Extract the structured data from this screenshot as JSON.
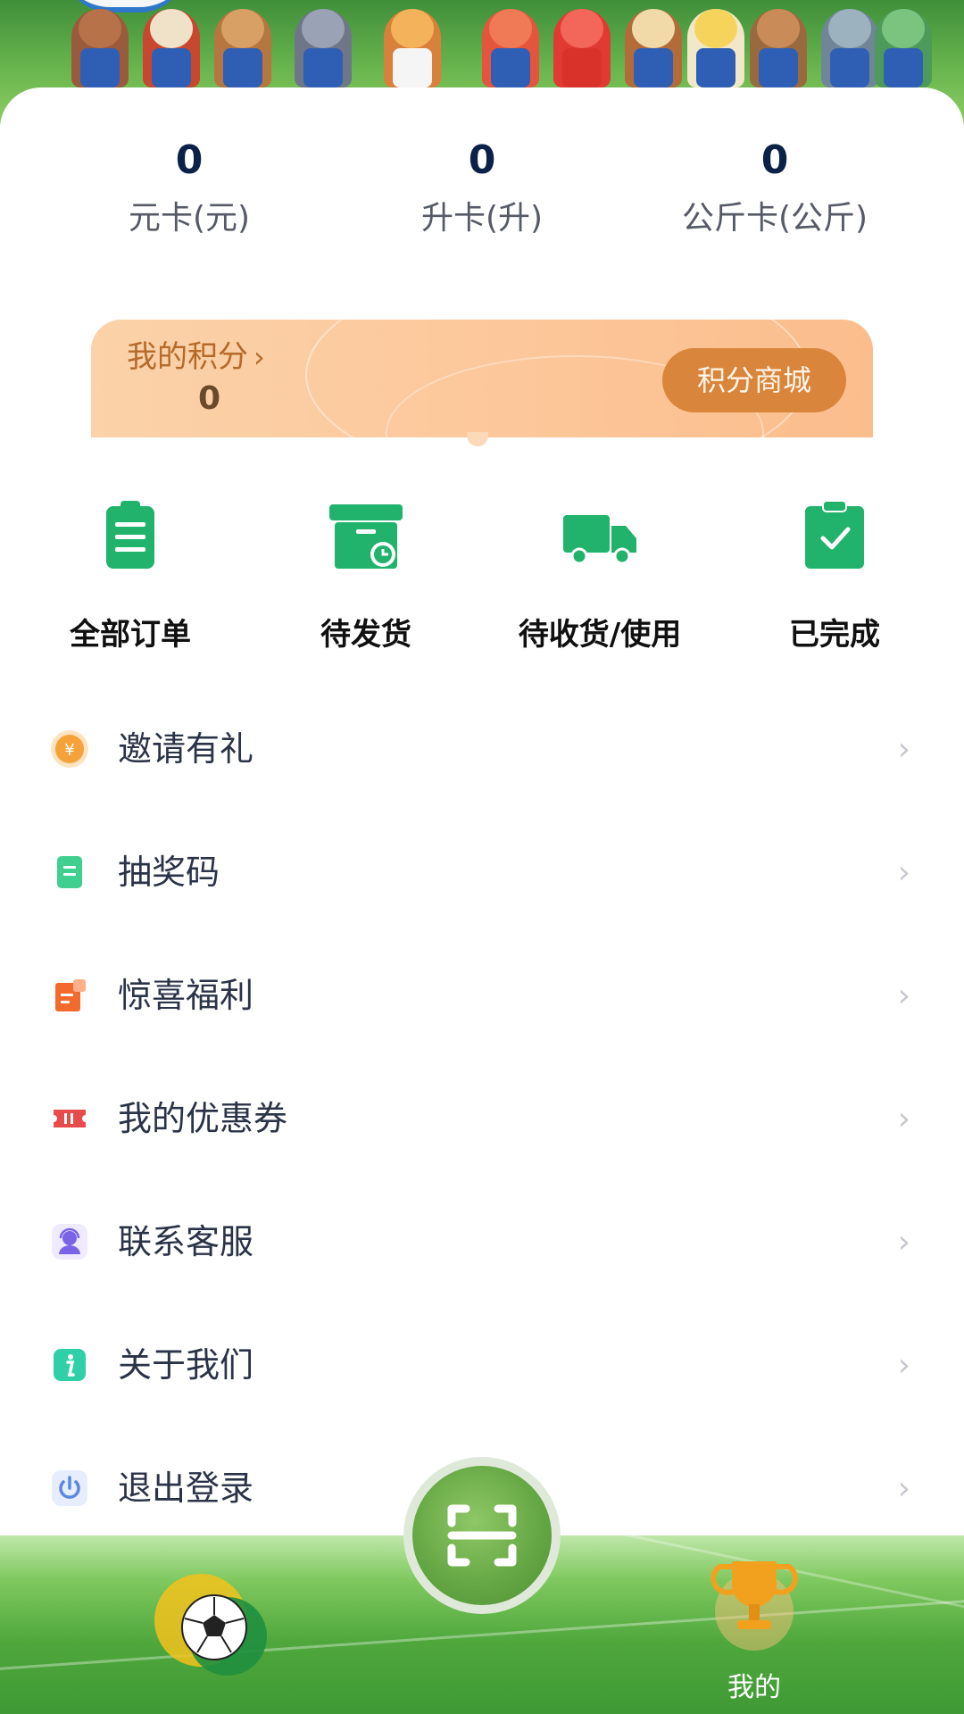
{
  "stats": [
    {
      "value": "0",
      "label": "元卡(元)"
    },
    {
      "value": "0",
      "label": "升卡(升)"
    },
    {
      "value": "0",
      "label": "公斤卡(公斤)"
    }
  ],
  "points": {
    "title": "我的积分",
    "chevron": "›",
    "value": "0",
    "mall_button": "积分商城"
  },
  "orders": [
    {
      "label": "全部订单",
      "icon": "clipboard-list-icon"
    },
    {
      "label": "待发货",
      "icon": "box-clock-icon"
    },
    {
      "label": "待收货/使用",
      "icon": "truck-icon"
    },
    {
      "label": "已完成",
      "icon": "clipboard-check-icon"
    }
  ],
  "menu": [
    {
      "label": "邀请有礼",
      "icon": "coin-icon",
      "color": "#f5a23a"
    },
    {
      "label": "抽奖码",
      "icon": "ticket-code-icon",
      "color": "#3fcf8e"
    },
    {
      "label": "惊喜福利",
      "icon": "gift-doc-icon",
      "color": "#f26a2e"
    },
    {
      "label": "我的优惠券",
      "icon": "coupon-icon",
      "color": "#e84b4b"
    },
    {
      "label": "联系客服",
      "icon": "support-agent-icon",
      "color": "#7a63e6"
    },
    {
      "label": "关于我们",
      "icon": "info-icon",
      "color": "#2fd0a8"
    },
    {
      "label": "退出登录",
      "icon": "power-icon",
      "color": "#5b86e5"
    }
  ],
  "menu_arrow": "›",
  "nav": {
    "mine_label": "我的",
    "home_icon": "soccer-ball-icon",
    "scan_icon": "scan-icon",
    "mine_icon": "trophy-icon"
  },
  "colors": {
    "accent_green": "#21b36b",
    "points_orange": "#d9853b",
    "stat_number": "#0c2148"
  }
}
